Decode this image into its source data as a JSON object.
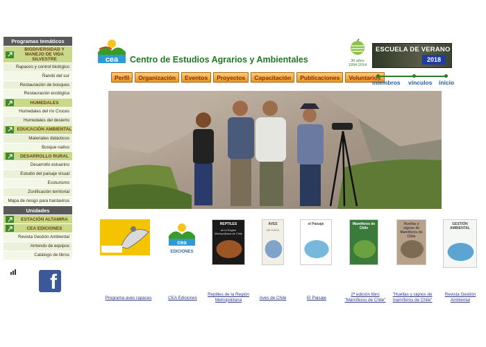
{
  "sidebar": {
    "header1": "Programas temáticos",
    "groups": [
      {
        "title": "BIODIVERSIDAD Y MANEJO DE VIDA SILVESTRE",
        "items": [
          "Rapaces y control biológico",
          "Ñandú del sur",
          "Restauración de bosques",
          "Restauración ecológica"
        ]
      },
      {
        "title": "HUMEDALES",
        "items": [
          "Humedales del río Cruces",
          "Humedales del desierto"
        ]
      },
      {
        "title": "EDUCACIÓN AMBIENTAL",
        "items": [
          "Materiales didácticos",
          "Bosque nativo"
        ]
      },
      {
        "title": "DESARROLLO RURAL",
        "items": [
          "Desarrollo estuarino",
          "Estudio del paisaje visual",
          "Ecoturismo",
          "Zonificación territorial",
          "Mapa de riesgo para hantavirus"
        ]
      }
    ],
    "header2": "Unidades",
    "units": [
      {
        "title": "ESTACIÓN ALTAMIRA",
        "items": []
      },
      {
        "title": "CEA EDICIONES",
        "items": [
          "Revista Gestión Ambiental",
          "Arriendo de equipos",
          "Catálogo de libros"
        ]
      }
    ]
  },
  "header": {
    "logo_text": "cea",
    "org_name": "Centro de Estudios Agrarios y Ambientales",
    "anniv_line1": "30 años",
    "anniv_line2": "1994-2014",
    "summer_title": "ESCUELA DE VERANO",
    "summer_year": "2018"
  },
  "nav": [
    "Perfil",
    "Organización",
    "Eventos",
    "Proyectos",
    "Capacitación",
    "Publicaciones",
    "Voluntarios"
  ],
  "member_links": [
    "miembros",
    "vínculos",
    "inicio"
  ],
  "books": [
    {
      "link": "Programa aves rapaces",
      "cover": "raptors"
    },
    {
      "link": "CEA Ediciones",
      "cover": "cea"
    },
    {
      "link": "Reptiles de la Región Metropolitana",
      "cover_title": "REPTILES",
      "cover_sub": "de la Región Metropolitana de Chile"
    },
    {
      "link": "Aves de Chile",
      "cover_title": "AVES",
      "cover_sub": "DE CHILE"
    },
    {
      "link": "El Paisaje",
      "cover_title": "el Paisaje"
    },
    {
      "link": "2ª edición libro \"Mamíferos de Chile\"",
      "cover_title": "Mamíferos de Chile"
    },
    {
      "link": "\"Huellas y signos de mamíferos de Chile\"",
      "cover_title": "Huellas y signos de Mamíferos de Chile"
    },
    {
      "link": "Revista Gestión Ambiental",
      "cover_title": "GESTIÓN AMBIENTAL"
    }
  ],
  "colors": {
    "brand_green": "#1e7a1e",
    "nav_orange": "#e89326",
    "sidebar_section": "#c9d98a",
    "facebook": "#3b5998"
  },
  "icons": {
    "section_arrow": "arrow-up-right-icon",
    "facebook": "facebook-icon",
    "stats": "bar-chart-icon"
  }
}
